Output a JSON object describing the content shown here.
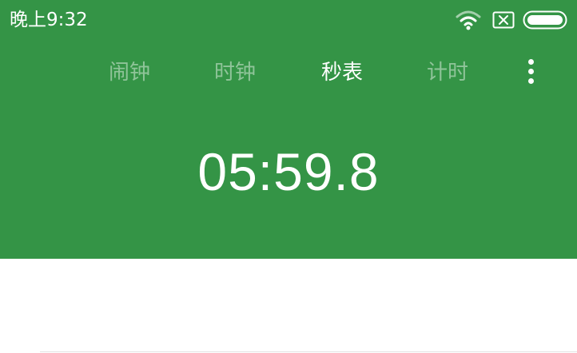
{
  "status_bar": {
    "time": "晚上9:32",
    "icons": [
      "wifi-icon",
      "sim-off-icon",
      "battery-icon"
    ]
  },
  "tabs": [
    {
      "label": "闹钟",
      "active": false
    },
    {
      "label": "时钟",
      "active": false
    },
    {
      "label": "秒表",
      "active": true
    },
    {
      "label": "计时",
      "active": false
    }
  ],
  "menu": {
    "icon": "more-vertical-icon"
  },
  "stopwatch": {
    "elapsed": "05:59.8"
  },
  "colors": {
    "header_background": "#349446",
    "content_background": "#ffffff",
    "active_tab_text": "#ffffff",
    "inactive_tab_text": "rgba(255,255,255,0.45)"
  }
}
